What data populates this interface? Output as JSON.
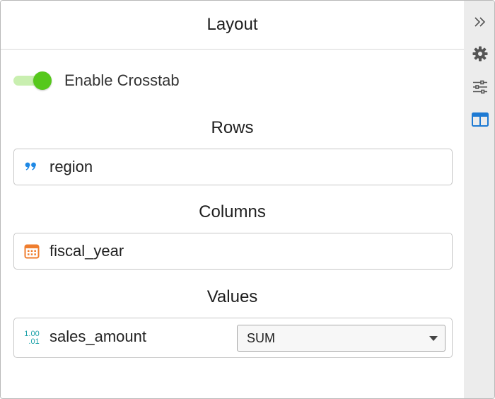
{
  "header": {
    "title": "Layout"
  },
  "crosstab": {
    "label": "Enable Crosstab",
    "enabled": true
  },
  "rows": {
    "title": "Rows",
    "field": "region",
    "icon": "text-quote-icon"
  },
  "columns": {
    "title": "Columns",
    "field": "fiscal_year",
    "icon": "calendar-icon"
  },
  "values": {
    "title": "Values",
    "field": "sales_amount",
    "icon": "numeric-icon",
    "icon_text_top": "1.00",
    "icon_text_bottom": ".01",
    "aggregate": "SUM"
  },
  "sidebar": {
    "items": [
      {
        "icon": "double-chevron-right-icon"
      },
      {
        "icon": "gear-icon"
      },
      {
        "icon": "sliders-icon"
      },
      {
        "icon": "table-layout-icon",
        "active": true
      }
    ]
  },
  "colors": {
    "toggle_on": "#56c81c",
    "toggle_track": "#c9efb0",
    "quote_icon": "#1e88e5",
    "calendar_icon": "#ef7d2e",
    "numeric_icon": "#1aa1a8",
    "active_sidebar_icon": "#1e7ad3"
  }
}
